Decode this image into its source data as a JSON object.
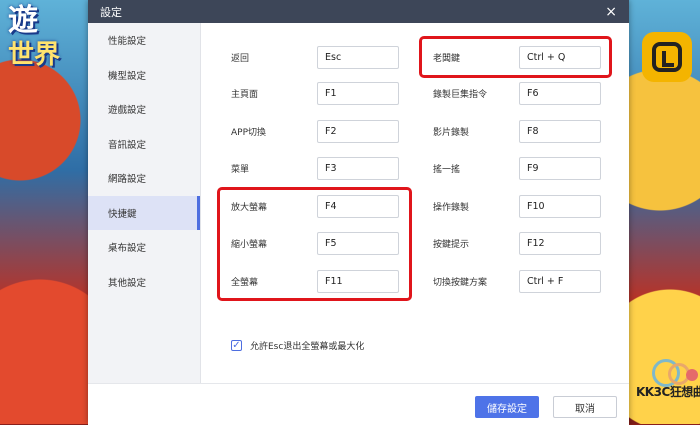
{
  "background": {
    "logo_line1": "遊",
    "logo_line2": "世界"
  },
  "dialog": {
    "title": "設定",
    "close_icon": "×"
  },
  "sidebar": {
    "items": [
      {
        "label": "性能設定"
      },
      {
        "label": "機型設定"
      },
      {
        "label": "遊戲設定"
      },
      {
        "label": "音訊設定"
      },
      {
        "label": "網路設定"
      },
      {
        "label": "快捷鍵"
      },
      {
        "label": "桌布設定"
      },
      {
        "label": "其他設定"
      }
    ],
    "active_index": 5
  },
  "shortcuts": {
    "left": [
      {
        "label": "返回",
        "key": "Esc"
      },
      {
        "label": "主頁面",
        "key": "F1"
      },
      {
        "label": "APP切換",
        "key": "F2"
      },
      {
        "label": "菜單",
        "key": "F3"
      },
      {
        "label": "放大螢幕",
        "key": "F4"
      },
      {
        "label": "縮小螢幕",
        "key": "F5"
      },
      {
        "label": "全螢幕",
        "key": "F11"
      }
    ],
    "right": [
      {
        "label": "老闆鍵",
        "key": "Ctrl + Q"
      },
      {
        "label": "錄製巨集指令",
        "key": "F6"
      },
      {
        "label": "影片錄製",
        "key": "F8"
      },
      {
        "label": "搖一搖",
        "key": "F9"
      },
      {
        "label": "操作錄製",
        "key": "F10"
      },
      {
        "label": "按鍵提示",
        "key": "F12"
      },
      {
        "label": "切換按鍵方案",
        "key": "Ctrl + F"
      }
    ]
  },
  "options": {
    "esc_exit_fullscreen": {
      "label": "允許Esc退出全螢幕或最大化",
      "checked": true,
      "check_glyph": "✓"
    }
  },
  "watermark": {
    "text_a": "KK3C",
    "text_b": "狂想曲"
  },
  "footer": {
    "save_label": "儲存設定",
    "cancel_label": "取消"
  },
  "colors": {
    "accent": "#4e73e8",
    "highlight": "#e0151b",
    "titlebar": "#3d4658"
  }
}
